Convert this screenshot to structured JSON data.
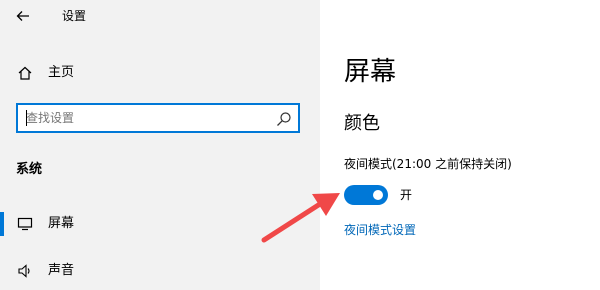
{
  "window": {
    "title": "设置",
    "back_icon": "back-arrow-icon"
  },
  "sidebar": {
    "home": {
      "label": "主页",
      "icon": "home-icon"
    },
    "search": {
      "placeholder": "查找设置",
      "value": "",
      "icon": "search-icon"
    },
    "section_header": "系统",
    "items": [
      {
        "label": "屏幕",
        "icon": "monitor-icon",
        "selected": true
      },
      {
        "label": "声音",
        "icon": "speaker-icon",
        "selected": false
      }
    ]
  },
  "main": {
    "title": "屏幕",
    "subheading": "颜色",
    "night_light": {
      "label": "夜间模式(21:00 之前保持关闭)",
      "toggle_on": true,
      "state_label": "开"
    },
    "settings_link": "夜间模式设置"
  },
  "colors": {
    "accent": "#0078d7",
    "link": "#0067b8",
    "sidebar_bg": "#f2f2f2",
    "annotation_arrow": "#f04848"
  }
}
